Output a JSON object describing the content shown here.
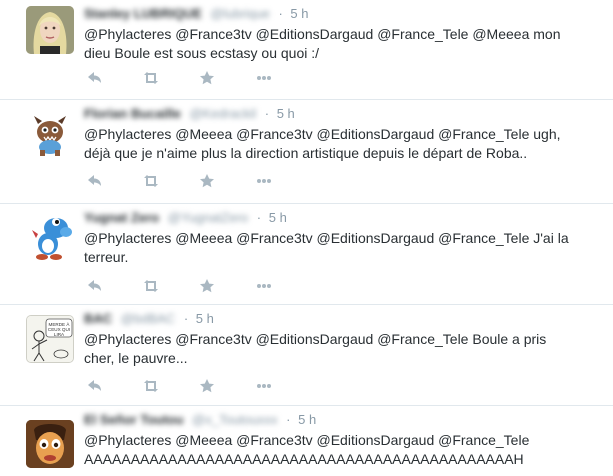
{
  "tweets": [
    {
      "name": "Stanley LUBRIQUE",
      "handle": "@lubrique",
      "separator": "·",
      "time": "5 h",
      "text_line1": "@Phylacteres @France3tv @EditionsDargaud @France_Tele @Meeea mon",
      "text_line2": "dieu Boule est sous ecstasy ou quoi :/",
      "avatar": "woman-blonde-avatar"
    },
    {
      "name": "Florian Bucaille",
      "handle": "@Kedrackil",
      "separator": "·",
      "time": "5 h",
      "text_line1": "@Phylacteres @Meeea @France3tv @EditionsDargaud @France_Tele ugh,",
      "text_line2": "déjà que je n'aime plus la direction artistique depuis le départ de Roba..",
      "avatar": "brown-creature-avatar"
    },
    {
      "name": "Yugnat Zero",
      "handle": "@YugnatZero",
      "separator": "·",
      "time": "5 h",
      "text_line1": "@Phylacteres @Meeea @France3tv @EditionsDargaud @France_Tele J'ai la",
      "text_line2": "terreur.",
      "avatar": "blue-yoshi-avatar"
    },
    {
      "name": "BAC",
      "handle": "@bdBAC",
      "separator": "·",
      "time": "5 h",
      "text_line1": "@Phylacteres @France3tv @EditionsDargaud @France_Tele Boule a pris",
      "text_line2": "cher, le pauvre...",
      "avatar": "sketch-drawing-avatar",
      "avatar_caption": "MERDE À CEUX QUI LIRA"
    },
    {
      "name": "El Señor Toutou",
      "handle": "@x_Toutouxxx",
      "separator": "·",
      "time": "5 h",
      "text_line1": "@Phylacteres @Meeea @France3tv @EditionsDargaud @France_Tele",
      "text_line2": "AAAAAAAAAAAAAAAAAAAAAAAAAAAAAAAAAAAAAAAAAAAAAAH",
      "avatar": "cartoon-face-avatar"
    }
  ],
  "icons": {
    "reply": "reply-icon",
    "retweet": "retweet-icon",
    "favorite": "star-icon",
    "more": "more-icon"
  },
  "colors": {
    "text": "#292f33",
    "meta": "#8899a6",
    "icons": "#aab8c2",
    "divider": "#e1e8ed"
  }
}
